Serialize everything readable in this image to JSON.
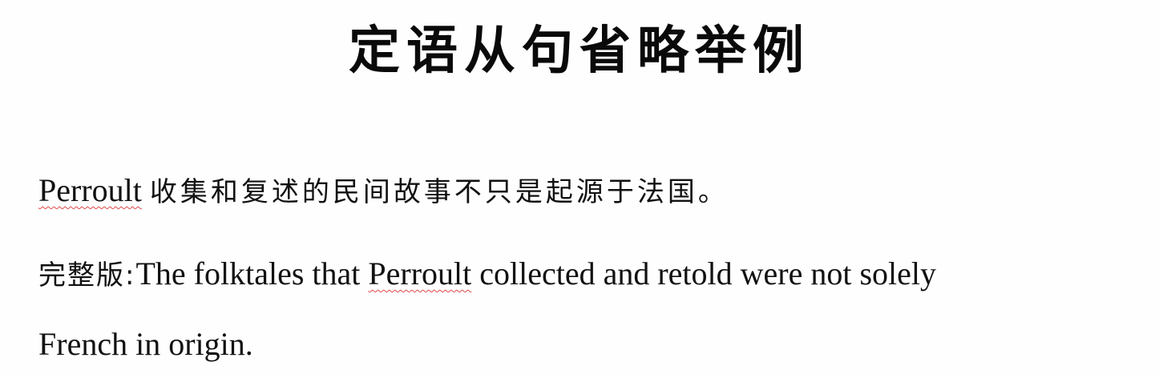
{
  "title": "定语从句省略举例",
  "example": {
    "name": "Perroult",
    "chinese_rest": "收集和复述的民间故事不只是起源于法国。",
    "full_label": "完整版:",
    "english_part1": "The folktales that ",
    "english_name": "Perroult",
    "english_part2": " collected and retold were not solely",
    "english_line2": "French in origin."
  }
}
